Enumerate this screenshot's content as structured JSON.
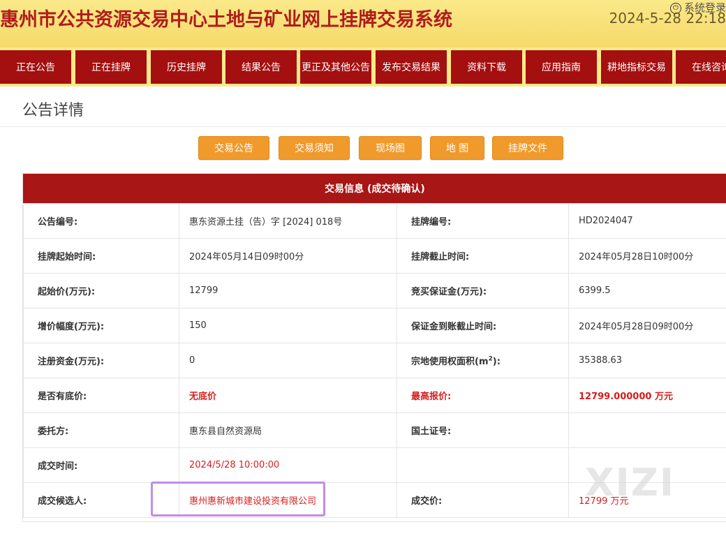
{
  "header": {
    "title": "惠州市公共资源交易中心土地与矿业网上挂牌交易系统",
    "login_label": "系统登录",
    "datetime": "2024-5-28 22:18"
  },
  "nav": {
    "items": [
      {
        "label": "正在公告"
      },
      {
        "label": "正在挂牌"
      },
      {
        "label": "历史挂牌"
      },
      {
        "label": "结果公告"
      },
      {
        "label": "更正及其他公告"
      },
      {
        "label": "发布交易结果"
      },
      {
        "label": "资料下载"
      },
      {
        "label": "应用指南"
      },
      {
        "label": "耕地指标交易"
      },
      {
        "label": "在线咨询"
      }
    ]
  },
  "page": {
    "title": "公告详情"
  },
  "tabs": [
    {
      "label": "交易公告"
    },
    {
      "label": "交易须知"
    },
    {
      "label": "现场图"
    },
    {
      "label": "地 图"
    },
    {
      "label": "挂牌文件"
    }
  ],
  "info": {
    "heading": "交易信息 (成交待确认)",
    "rows": [
      {
        "l1": "公告编号:",
        "v1": "惠东资源土挂（告）字 [2024] 018号",
        "l2": "挂牌编号:",
        "v2": "HD2024047"
      },
      {
        "l1": "挂牌起始时间:",
        "v1": "2024年05月14日09时00分",
        "l2": "挂牌截止时间:",
        "v2": "2024年05月28日10时00分"
      },
      {
        "l1": "起始价(万元):",
        "v1": "12799",
        "l2": "竞买保证金(万元):",
        "v2": "6399.5"
      },
      {
        "l1": "增价幅度(万元):",
        "v1": "150",
        "l2": "保证金到账截止时间:",
        "v2": "2024年05月28日09时00分"
      },
      {
        "l1": "注册资金(万元):",
        "v1": "0",
        "l2": "宗地使用权面积(m",
        "l2_sup": "2",
        "l2_tail": "):",
        "v2": "35388.63"
      },
      {
        "l1": "是否有底价:",
        "v1": "无底价",
        "l2": "最高报价:",
        "v2": "12799.000000 万元"
      },
      {
        "l1": "委托方:",
        "v1": "惠东县自然资源局",
        "l2": "国土证号:",
        "v2": ""
      },
      {
        "l1": "成交时间:",
        "v1": "2024/5/28 10:00:00"
      },
      {
        "l1": "成交候选人:",
        "v1": "惠州惠新城市建设投资有限公司",
        "l2": "成交价:",
        "v2": "12799 万元"
      }
    ]
  },
  "watermark": "XIZI",
  "colors": {
    "header_bg": "#fbe98a",
    "nav_bg": "#a40f0f",
    "tab_bg": "#f09a2c",
    "panel_head_bg": "#a81616",
    "highlight": "#c38be6",
    "alert_text": "#d91c1c"
  }
}
